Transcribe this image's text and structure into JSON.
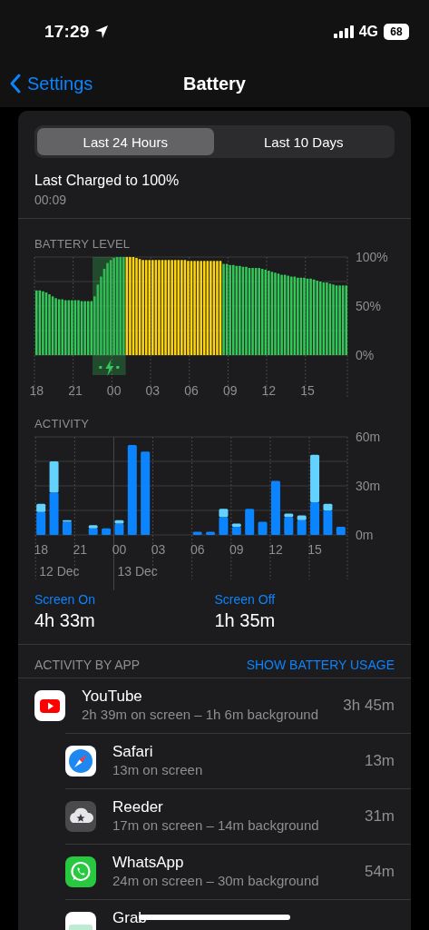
{
  "status_bar": {
    "time": "17:29",
    "network": "4G",
    "battery": "68"
  },
  "nav": {
    "back": "Settings",
    "title": "Battery"
  },
  "tabs": [
    {
      "label": "Last 24 Hours",
      "selected": true
    },
    {
      "label": "Last 10 Days",
      "selected": false
    }
  ],
  "last_charged": {
    "title": "Last Charged to 100%",
    "time": "00:09"
  },
  "battery_level": {
    "title": "BATTERY LEVEL",
    "charging": [
      false,
      false,
      false,
      false,
      false,
      false,
      false,
      false,
      false,
      false,
      false,
      false,
      false,
      false,
      false,
      false,
      false,
      false,
      true,
      true,
      true,
      true,
      true,
      true,
      true,
      true,
      true,
      true,
      false,
      false,
      false,
      false,
      false,
      false,
      false,
      false,
      false,
      false,
      false,
      false,
      false,
      false,
      false,
      false,
      false,
      false,
      false,
      false,
      false,
      false,
      false,
      false,
      false,
      false,
      false,
      false,
      false,
      false,
      false,
      false,
      false,
      false,
      false,
      false,
      false,
      false,
      false,
      false,
      false,
      false,
      false,
      false,
      false,
      false,
      false,
      false,
      false,
      false,
      false,
      false,
      false,
      false,
      false,
      false,
      false,
      false,
      false,
      false,
      false,
      false,
      false,
      false,
      false,
      false,
      false,
      false,
      false
    ],
    "chart_data": {
      "type": "bar",
      "stacked": false,
      "ylim": [
        0,
        100
      ],
      "yticks": [
        {
          "value": 0,
          "label": "0%"
        },
        {
          "value": 50,
          "label": "50%"
        },
        {
          "value": 100,
          "label": "100%"
        }
      ],
      "categories": [
        "18",
        null,
        null,
        null,
        null,
        null,
        null,
        null,
        null,
        null,
        null,
        null,
        "21",
        null,
        null,
        null,
        null,
        null,
        null,
        null,
        null,
        null,
        null,
        null,
        "00",
        null,
        null,
        null,
        null,
        null,
        null,
        null,
        null,
        null,
        null,
        null,
        "03",
        null,
        null,
        null,
        null,
        null,
        null,
        null,
        null,
        null,
        null,
        null,
        "06",
        null,
        null,
        null,
        null,
        null,
        null,
        null,
        null,
        null,
        null,
        null,
        "09",
        null,
        null,
        null,
        null,
        null,
        null,
        null,
        null,
        null,
        null,
        null,
        "12",
        null,
        null,
        null,
        null,
        null,
        null,
        null,
        null,
        null,
        null,
        null,
        "15",
        null,
        null,
        null,
        null,
        null,
        null,
        null,
        null,
        null,
        null,
        null,
        null
      ],
      "series": [
        {
          "color": "#34c759",
          "values": [
            66,
            66,
            65,
            64,
            62,
            60,
            58,
            57,
            57,
            56,
            56,
            56,
            56,
            56,
            55,
            55,
            55,
            55,
            60,
            72,
            80,
            88,
            94,
            97,
            99,
            100,
            100,
            100,
            null,
            null,
            null,
            null,
            null,
            null,
            null,
            null,
            null,
            null,
            null,
            null,
            null,
            null,
            null,
            null,
            null,
            null,
            null,
            null,
            null,
            null,
            null,
            null,
            null,
            null,
            null,
            null,
            null,
            null,
            93,
            93,
            92,
            92,
            91,
            91,
            90,
            90,
            89,
            89,
            89,
            89,
            88,
            87,
            86,
            85,
            84,
            83,
            82,
            82,
            81,
            80,
            80,
            79,
            79,
            79,
            78,
            78,
            77,
            76,
            75,
            74,
            74,
            73,
            72,
            71,
            71,
            71,
            71
          ]
        },
        {
          "color": "#ffd60a",
          "values": [
            null,
            null,
            null,
            null,
            null,
            null,
            null,
            null,
            null,
            null,
            null,
            null,
            null,
            null,
            null,
            null,
            null,
            null,
            null,
            null,
            null,
            null,
            null,
            null,
            null,
            null,
            null,
            null,
            100,
            100,
            100,
            99,
            98,
            97,
            97,
            97,
            97,
            97,
            97,
            97,
            97,
            97,
            97,
            97,
            97,
            97,
            97,
            96,
            96,
            96,
            96,
            96,
            96,
            96,
            96,
            96,
            96,
            96,
            null,
            null,
            null,
            null,
            null,
            null,
            null,
            null,
            null,
            null,
            null,
            null,
            null,
            null,
            null,
            null,
            null,
            null,
            null,
            null,
            null,
            null,
            null,
            null,
            null,
            null,
            null,
            null,
            null,
            null,
            null,
            null,
            null,
            null,
            null,
            null,
            null,
            null,
            null
          ]
        }
      ]
    }
  },
  "activity": {
    "title": "ACTIVITY",
    "chart_data": {
      "type": "bar",
      "stacked": true,
      "annotations": [
        "12 Dec",
        "13 Dec"
      ],
      "ylim": [
        0,
        60
      ],
      "yticks": [
        {
          "value": 0,
          "label": "0m"
        },
        {
          "value": 30,
          "label": "30m"
        },
        {
          "value": 60,
          "label": "60m"
        }
      ],
      "categories": [
        "18",
        null,
        null,
        "21",
        null,
        null,
        "00",
        null,
        null,
        "03",
        null,
        null,
        "06",
        null,
        null,
        "09",
        null,
        null,
        "12",
        null,
        null,
        "15",
        null,
        null
      ],
      "series": [
        {
          "name": "Screen On",
          "color": "#0a84ff",
          "values": [
            14,
            26,
            8,
            0,
            4,
            4,
            7,
            55,
            51,
            0,
            0,
            0,
            2,
            2,
            11,
            5,
            16,
            8,
            33,
            11,
            9,
            20,
            15,
            5
          ]
        },
        {
          "name": "Screen Off",
          "color": "#64d2ff",
          "values": [
            5,
            19,
            1,
            0,
            2,
            0,
            2,
            0,
            0,
            0,
            0,
            0,
            0,
            0,
            5,
            2,
            0,
            0,
            0,
            2,
            3,
            29,
            4,
            0
          ]
        }
      ]
    }
  },
  "screen_time": [
    {
      "value": "4h 33m"
    },
    {
      "value": "1h 35m"
    }
  ],
  "apps_header": {
    "title": "ACTIVITY BY APP",
    "action": "SHOW BATTERY USAGE"
  },
  "apps": [
    {
      "kind": "youtube",
      "name": "YouTube",
      "detail": "2h 39m on screen – 1h 6m background",
      "usage": "3h 45m"
    },
    {
      "kind": "safari",
      "name": "Safari",
      "detail": "13m on screen",
      "usage": "13m"
    },
    {
      "kind": "reeder",
      "name": "Reeder",
      "detail": "17m on screen – 14m background",
      "usage": "31m"
    },
    {
      "kind": "whatsapp",
      "name": "WhatsApp",
      "detail": "24m on screen – 30m background",
      "usage": "54m"
    },
    {
      "kind": "grab",
      "name": "Grab"
    }
  ]
}
